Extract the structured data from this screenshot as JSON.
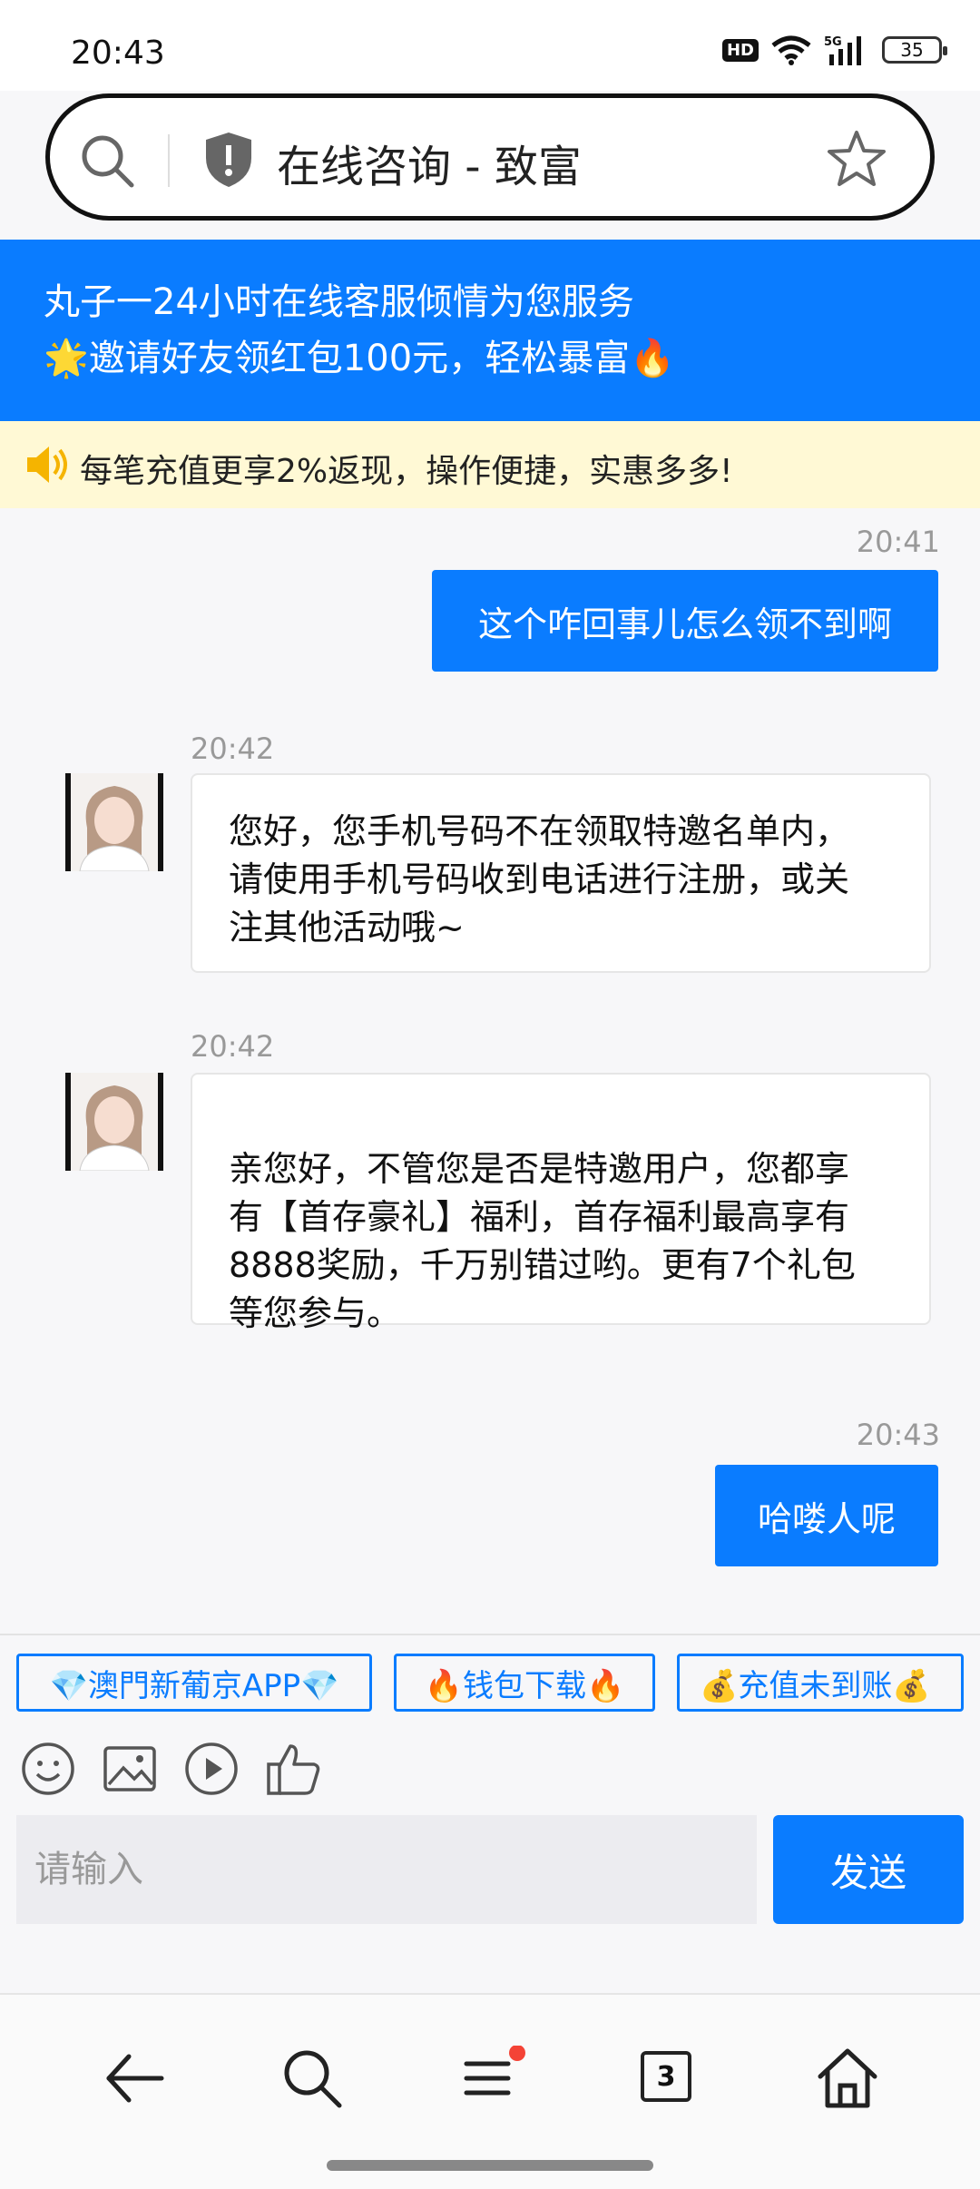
{
  "status": {
    "time": "20:43",
    "battery": "35",
    "hd": "HD",
    "net": "5G"
  },
  "address_bar": {
    "title": "在线咨询 - 致富"
  },
  "banner": {
    "line1": "丸子一24小时在线客服倾情为您服务",
    "line2": "🌟邀请好友领红包100元，轻松暴富🔥"
  },
  "notice": {
    "text": "每笔充值更享2%返现，操作便捷，实惠多多!"
  },
  "messages": [
    {
      "time": "20:41",
      "text": "这个咋回事儿怎么领不到啊"
    },
    {
      "time": "20:42",
      "lines": [
        "您好，您手机号码不在领取特邀名单内，",
        "请使用手机号码收到电话进行注册，或关",
        "注其他活动哦~"
      ]
    },
    {
      "time": "20:42",
      "lines": [
        "亲您好，不管您是否是特邀用户，您都享",
        "有【首存豪礼】福利，首存福利最高享有",
        "8888奖励，千万别错过哟。更有7个礼包",
        "等您参与。"
      ]
    },
    {
      "time": "20:43",
      "text": "哈喽人呢"
    }
  ],
  "quick_replies": [
    "💎澳門新葡京APP💎",
    "🔥钱包下载🔥",
    "💰充值未到账💰"
  ],
  "composer": {
    "placeholder": "请输入",
    "send_label": "发送"
  },
  "nav": {
    "tabs_count": "3"
  },
  "colors": {
    "accent": "#0a7cff",
    "notice_bg": "#fff9d5",
    "badge_dot": "#f44336"
  }
}
